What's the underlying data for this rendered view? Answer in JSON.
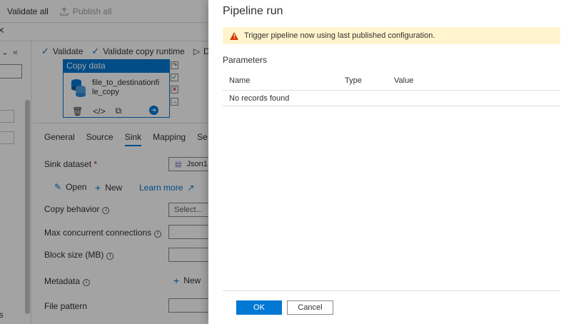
{
  "toolbar": {
    "validate_all": "Validate all",
    "publish_all": "Publish all"
  },
  "resources": {
    "bottom_text": "ls"
  },
  "canvas_toolbar": {
    "validate": "Validate",
    "validate_copy_runtime": "Validate copy runtime",
    "debug_truncated": "D"
  },
  "activity": {
    "type": "Copy data",
    "name_line1": "file_to_destinationfi",
    "name_line2": "le_copy"
  },
  "settings_tabs": [
    "General",
    "Source",
    "Sink",
    "Mapping",
    "Se"
  ],
  "settings_active_tab": "Sink",
  "sink": {
    "dataset_label": "Sink dataset",
    "required_marker": "*",
    "dataset_value": "Json1",
    "open": "Open",
    "new": "New",
    "learn_more": "Learn more",
    "copy_behavior_label": "Copy behavior",
    "copy_behavior_placeholder": "Select...",
    "max_concurrent_label": "Max concurrent connections",
    "block_size_label": "Block size (MB)",
    "metadata_label": "Metadata",
    "metadata_new": "New",
    "file_pattern_label": "File pattern"
  },
  "panel": {
    "title": "Pipeline run",
    "warning": "Trigger pipeline now using last published configuration.",
    "parameters_label": "Parameters",
    "columns": [
      "Name",
      "Type",
      "Value"
    ],
    "empty_text": "No records found",
    "ok_label": "OK",
    "cancel_label": "Cancel"
  },
  "colors": {
    "accent": "#0078d4",
    "warning_bg": "#fff4ce",
    "warning_icon": "#d83b01"
  }
}
